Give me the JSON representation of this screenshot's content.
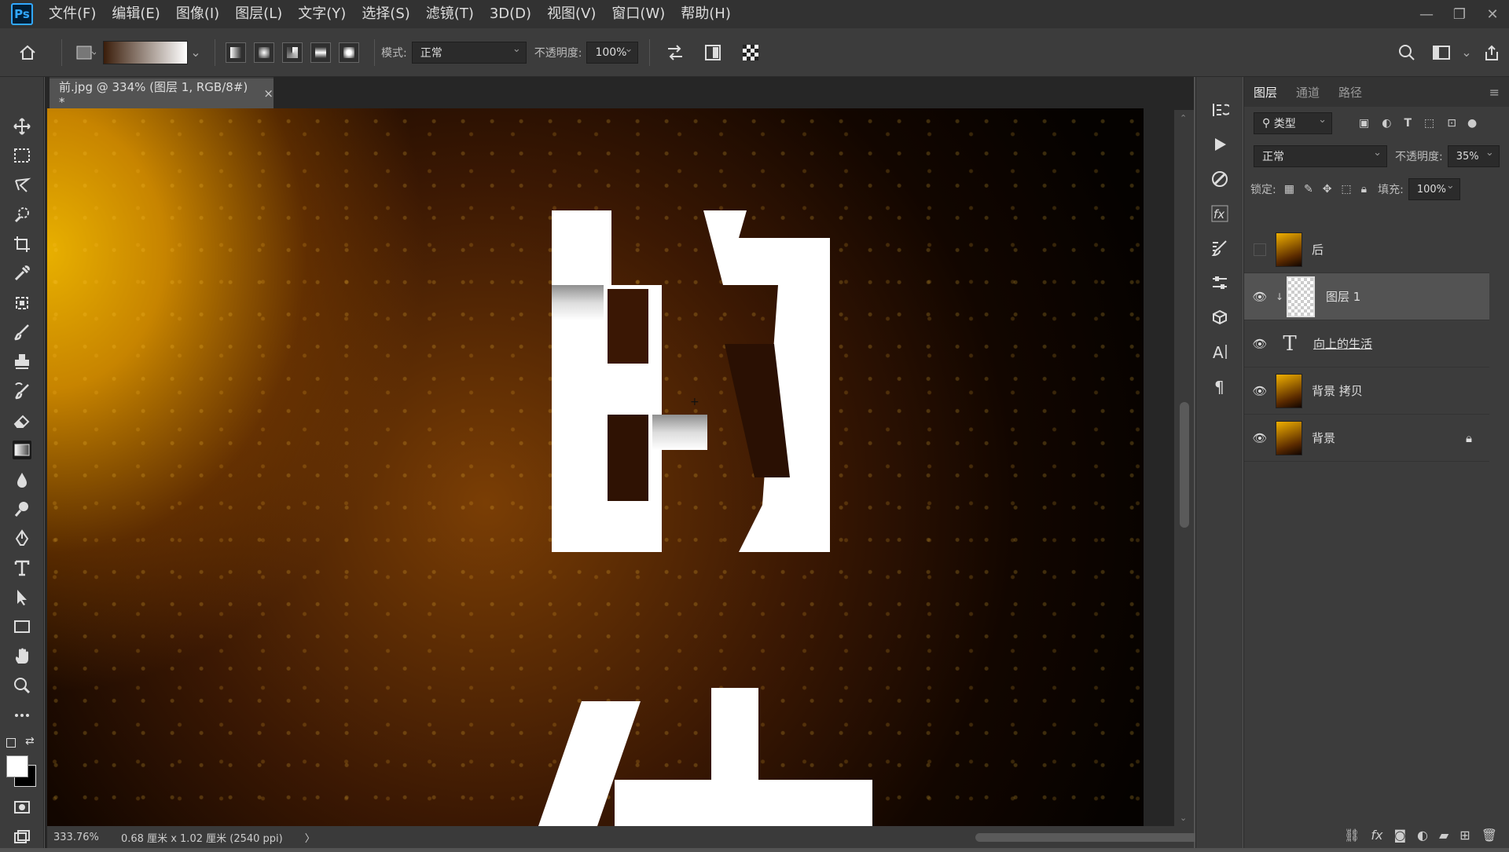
{
  "app": {
    "logo": "Ps"
  },
  "menu": [
    "文件(F)",
    "编辑(E)",
    "图像(I)",
    "图层(L)",
    "文字(Y)",
    "选择(S)",
    "滤镜(T)",
    "3D(D)",
    "视图(V)",
    "窗口(W)",
    "帮助(H)"
  ],
  "options": {
    "mode_label": "模式:",
    "mode_value": "正常",
    "opacity_label": "不透明度:",
    "opacity_value": "100%"
  },
  "document": {
    "tab_title": "前.jpg @ 334% (图层 1, RGB/8#) *",
    "close": "×"
  },
  "canvas": {
    "glyph_top": "的",
    "glyph_bottom": "生"
  },
  "status": {
    "zoom": "333.76%",
    "info": "0.68 厘米 x 1.02 厘米 (2540 ppi)",
    "arrow": "〉"
  },
  "panel": {
    "tabs": [
      "图层",
      "通道",
      "路径"
    ],
    "filter_label": "类型",
    "blend_mode": "正常",
    "opacity_label": "不透明度:",
    "opacity_value": "35%",
    "lock_label": "锁定:",
    "fill_label": "填充:",
    "fill_value": "100%",
    "layers": [
      {
        "name": "后",
        "visible": false,
        "kind": "image"
      },
      {
        "name": "图层 1",
        "visible": true,
        "kind": "transparent",
        "selected": true
      },
      {
        "name": "向上的生活",
        "visible": true,
        "kind": "text"
      },
      {
        "name": "背景 拷贝",
        "visible": true,
        "kind": "image"
      },
      {
        "name": "背景",
        "visible": true,
        "kind": "image",
        "locked": true
      }
    ]
  },
  "colors": {
    "accent": "#31a8ff",
    "canvas_gold": "#e8b000"
  }
}
